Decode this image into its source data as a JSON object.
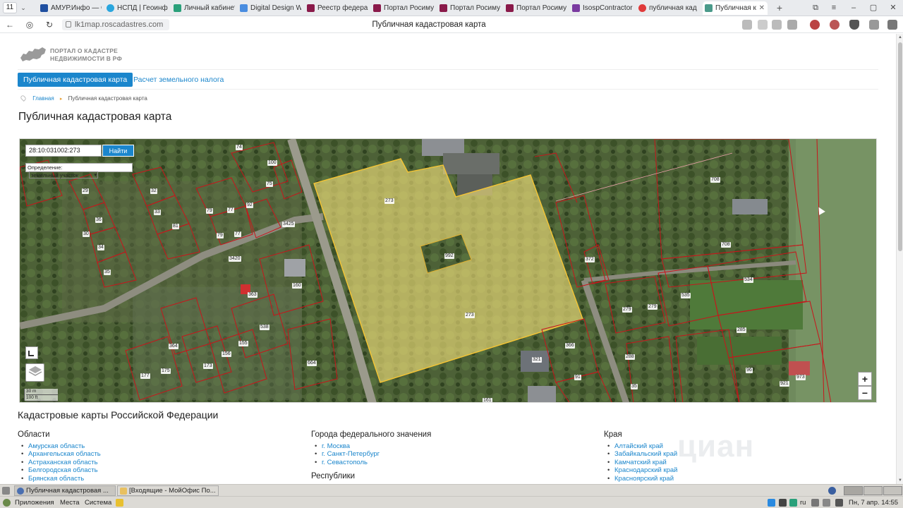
{
  "browser": {
    "tab_count": "11",
    "tabs": [
      {
        "label": "АМУР.Инфо — С",
        "color": "#1f4fa0"
      },
      {
        "label": "НСПД | Геоинф",
        "color": "#2aa6de"
      },
      {
        "label": "Личный кабинет",
        "color": "#2aa07a"
      },
      {
        "label": "Digital Design W",
        "color": "#4a8de0"
      },
      {
        "label": "Реестр федера",
        "color": "#8a1a4a"
      },
      {
        "label": "Портал Росиму",
        "color": "#8a1a4a"
      },
      {
        "label": "Портал Росиму",
        "color": "#8a1a4a"
      },
      {
        "label": "Портал Росиму",
        "color": "#8a1a4a"
      },
      {
        "label": "IsospContractor",
        "color": "#7a3aa0"
      },
      {
        "label": "публичная кад",
        "color": "#e03a3a"
      },
      {
        "label": "Публичная к",
        "color": "#4a9a8a"
      }
    ],
    "url": "lk1map.roscadastres.com",
    "page_title": "Публичная кадастровая карта"
  },
  "site": {
    "logo_line1": "ПОРТАЛ О КАДАСТРЕ",
    "logo_line2": "НЕДВИЖИМОСТИ В РФ",
    "nav_active": "Публичная кадастровая карта",
    "nav_link": "Расчет земельного налога",
    "breadcrumb_home": "Главная",
    "breadcrumb_current": "Публичная кадастровая карта",
    "heading": "Публичная кадастровая карта"
  },
  "map": {
    "search_value": "28:10:031002:273",
    "search_button": "Найти",
    "definition_label": "Определение:",
    "definition_value": "земельный участок",
    "zoom_in": "+",
    "zoom_out": "−",
    "scale_m": "30 m",
    "scale_ft": "100 ft",
    "parcel_labels": [
      "273",
      "273",
      "992",
      "74",
      "100",
      "75",
      "29",
      "32",
      "33",
      "79",
      "77",
      "92",
      "36",
      "30",
      "81",
      "79",
      "77",
      "34",
      "35",
      "3425",
      "3420",
      "160",
      "363",
      "538",
      "175",
      "177",
      "364",
      "173",
      "156",
      "155",
      "664",
      "372",
      "321",
      "366",
      "91",
      "161",
      "708",
      "708",
      "534",
      "535",
      "279",
      "279",
      "285",
      "96",
      "921",
      "973",
      "288",
      "35"
    ],
    "highlight_color": "#f5e27a"
  },
  "lower": {
    "title": "Кадастровые карты Российской Федерации",
    "col1_title": "Области",
    "col1_items": [
      "Амурская область",
      "Архангельская область",
      "Астраханская область",
      "Белгородская область",
      "Брянская область"
    ],
    "col2_title": "Города федерального значения",
    "col2_items": [
      "г. Москва",
      "г. Санкт-Петербург",
      "г. Севастополь"
    ],
    "col2_sub": "Республики",
    "col3_title": "Края",
    "col3_items": [
      "Алтайский край",
      "Забайкальский край",
      "Камчатский край",
      "Краснодарский край",
      "Красноярский край"
    ],
    "watermark": "циан"
  },
  "taskbar": {
    "task1": "Публичная кадастровая ...",
    "task2": "[Входящие - МойОфис По..."
  },
  "panel": {
    "apps": "Приложения",
    "places": "Места",
    "system": "Система",
    "lang": "ru",
    "clock": "Пн, 7 апр. 14:55"
  }
}
